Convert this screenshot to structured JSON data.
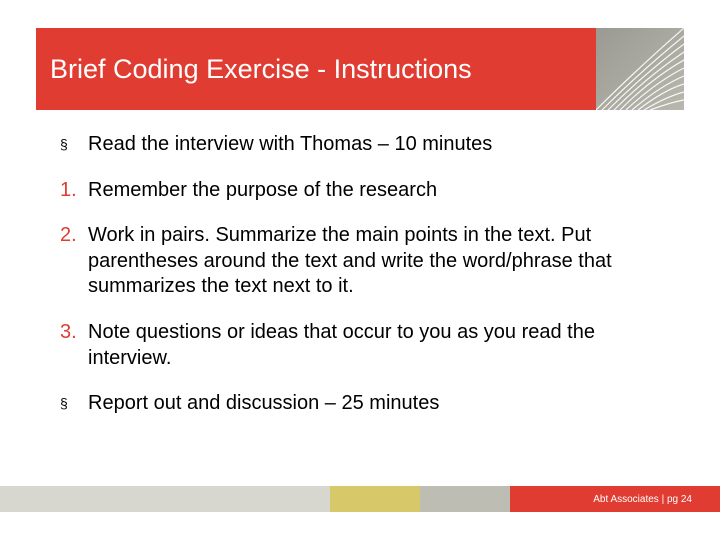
{
  "title": "Brief Coding Exercise - Instructions",
  "items": [
    {
      "marker": "§",
      "type": "sq",
      "text": "Read the interview with Thomas – 10 minutes"
    },
    {
      "marker": "1.",
      "type": "num",
      "text": "Remember the purpose of the research"
    },
    {
      "marker": "2.",
      "type": "num",
      "text": "Work in pairs.  Summarize the main points in the text.  Put parentheses around the text and write the word/phrase that summarizes the text next to it."
    },
    {
      "marker": "3.",
      "type": "num",
      "text": "Note questions or ideas that occur to you as you read the interview."
    },
    {
      "marker": "§",
      "type": "sq",
      "text": "Report out and discussion – 25 minutes"
    }
  ],
  "footer": "Abt Associates | pg 24"
}
